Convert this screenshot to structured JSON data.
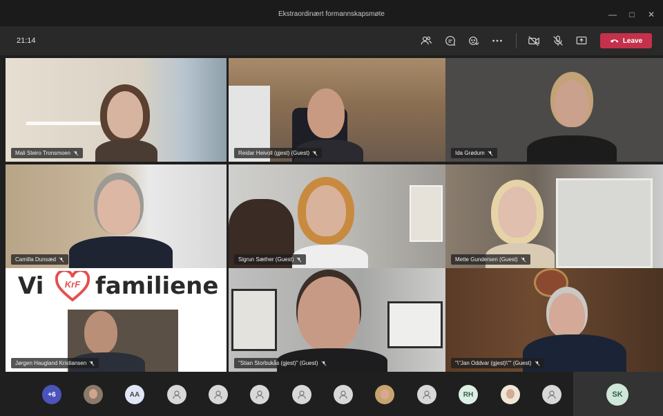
{
  "window": {
    "title": "Ekstraordinært formannskapsmøte",
    "controls": [
      "minimize",
      "maximize",
      "close"
    ]
  },
  "toolbar": {
    "clock": "21:14",
    "icons": [
      "people-icon",
      "chat-icon",
      "reactions-icon",
      "more-icon",
      "camera-off-icon",
      "mic-off-icon",
      "share-icon"
    ],
    "leave_label": "Leave",
    "leave_color": "#c4314b"
  },
  "participants": [
    {
      "name": "Mali Steiro Tronsmoen"
    },
    {
      "name": "Reidar Heivoll (gjest) (Guest)"
    },
    {
      "name": "Ida Grødum"
    },
    {
      "name": "Camilla Dunsæd"
    },
    {
      "name": "Sigrun Sæther (Guest)"
    },
    {
      "name": "Mette Gundersen (Guest)"
    },
    {
      "name": "Jørgen Haugland Kristiansen"
    },
    {
      "name": "\"Stian Storbukås (gjest)\" (Guest)"
    },
    {
      "name": "\"\\\"Jan Oddvar (gjest)\\\"\" (Guest)"
    }
  ],
  "banner": {
    "vi": "Vi",
    "logo": "KrF",
    "familiene": "familiene"
  },
  "tray": {
    "more_count": "+6",
    "initials": [
      "AA",
      "RH"
    ],
    "self_initials": "SK"
  }
}
